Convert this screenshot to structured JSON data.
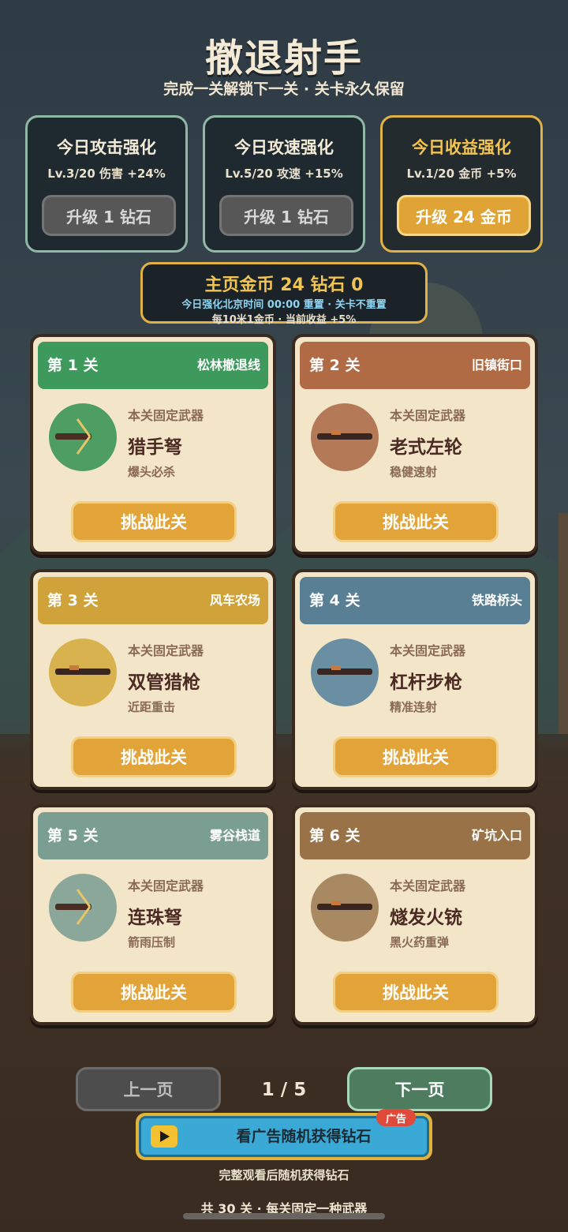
{
  "game": {
    "title": "撤退射手",
    "subtitle": "完成一关解锁下一关 · 关卡永久保留"
  },
  "upgrades": [
    {
      "name": "今日攻击强化",
      "level": "Lv.3/20  伤害 +24%",
      "button": "升级 1 钻石",
      "enabled": false
    },
    {
      "name": "今日攻速强化",
      "level": "Lv.5/20  攻速 +15%",
      "button": "升级 1 钻石",
      "enabled": false
    },
    {
      "name": "今日收益强化",
      "level": "Lv.1/20  金币 +5%",
      "button": "升级 24 金币",
      "enabled": true
    }
  ],
  "wallet": {
    "main": "主页金币  24    钻石  0",
    "line1": "今日强化北京时间 00:00 重置 · 关卡不重置",
    "line2": "每10米1金币 · 当前收益 +5%"
  },
  "levels": [
    {
      "label": "第 1 关",
      "place": "松林撤退线",
      "weapon_label": "本关固定武器",
      "weapon": "猎手弩",
      "desc": "爆头必杀",
      "button": "挑战此关",
      "color": "#3e9a5c",
      "circle": "#4e9e63",
      "icon": "crossbow-icon"
    },
    {
      "label": "第 2 关",
      "place": "旧镇街口",
      "weapon_label": "本关固定武器",
      "weapon": "老式左轮",
      "desc": "稳健速射",
      "button": "挑战此关",
      "color": "#b06a44",
      "circle": "#b47a58",
      "icon": "gun-icon"
    },
    {
      "label": "第 3 关",
      "place": "风车农场",
      "weapon_label": "本关固定武器",
      "weapon": "双管猎枪",
      "desc": "近距重击",
      "button": "挑战此关",
      "color": "#cfa23a",
      "circle": "#d8b24e",
      "icon": "gun-icon"
    },
    {
      "label": "第 4 关",
      "place": "铁路桥头",
      "weapon_label": "本关固定武器",
      "weapon": "杠杆步枪",
      "desc": "精准连射",
      "button": "挑战此关",
      "color": "#587f94",
      "circle": "#6a8fa2",
      "icon": "gun-icon"
    },
    {
      "label": "第 5 关",
      "place": "雾谷栈道",
      "weapon_label": "本关固定武器",
      "weapon": "连珠弩",
      "desc": "箭雨压制",
      "button": "挑战此关",
      "color": "#7b9e92",
      "circle": "#8aa79a",
      "icon": "crossbow-icon"
    },
    {
      "label": "第 6 关",
      "place": "矿坑入口",
      "weapon_label": "本关固定武器",
      "weapon": "燧发火铳",
      "desc": "黑火药重弹",
      "button": "挑战此关",
      "color": "#9a7248",
      "circle": "#a88962",
      "icon": "gun-icon"
    }
  ],
  "pager": {
    "prev": "上一页",
    "page": "1 / 5",
    "next": "下一页"
  },
  "ad": {
    "label": "看广告随机获得钻石",
    "badge": "广告",
    "note": "完整观看后随机获得钻石"
  },
  "footer": "共 30 关 · 每关固定一种武器"
}
